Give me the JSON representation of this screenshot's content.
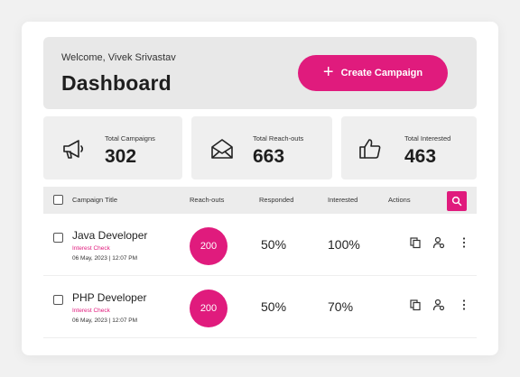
{
  "header": {
    "welcome": "Welcome, Vivek Srivastav",
    "title": "Dashboard",
    "create_label": "Create Campaign"
  },
  "stats": [
    {
      "label": "Total Campaigns",
      "value": "302",
      "icon": "megaphone-icon"
    },
    {
      "label": "Total Reach-outs",
      "value": "663",
      "icon": "envelope-icon"
    },
    {
      "label": "Total Interested",
      "value": "463",
      "icon": "thumbs-up-icon"
    }
  ],
  "table": {
    "columns": [
      "Campaign Title",
      "Reach-outs",
      "Responded",
      "Interested",
      "Actions"
    ],
    "rows": [
      {
        "title": "Java Developer",
        "tag": "Interest Check",
        "date": "06 May, 2023 | 12:07 PM",
        "reachouts": "200",
        "responded": "50%",
        "interested": "100%"
      },
      {
        "title": "PHP Developer",
        "tag": "Interest Check",
        "date": "06 May, 2023 | 12:07 PM",
        "reachouts": "200",
        "responded": "50%",
        "interested": "70%"
      }
    ]
  },
  "colors": {
    "accent": "#e01b7d",
    "panel": "#e8e8e8",
    "background": "#f1f1f1"
  }
}
